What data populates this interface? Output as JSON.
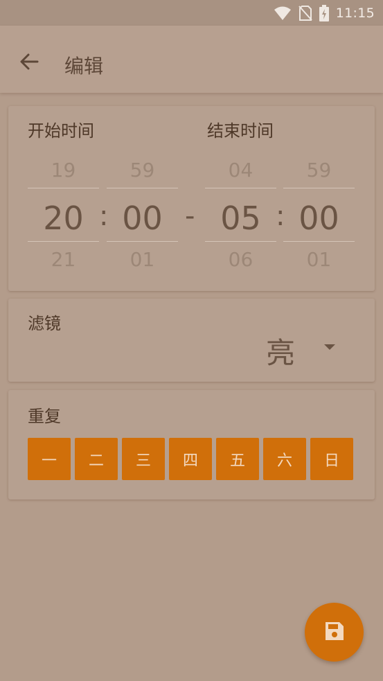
{
  "status_bar": {
    "time": "11:15",
    "icons": [
      "wifi-icon",
      "no-sim-icon",
      "battery-charging-icon"
    ]
  },
  "toolbar": {
    "title": "编辑",
    "back_icon": "arrow-back-icon"
  },
  "time_card": {
    "start_label": "开始时间",
    "end_label": "结束时间",
    "separator_colon": ":",
    "separator_dash": "-",
    "start_hour": {
      "prev": "19",
      "current": "20",
      "next": "21"
    },
    "start_minute": {
      "prev": "59",
      "current": "00",
      "next": "01"
    },
    "end_hour": {
      "prev": "04",
      "current": "05",
      "next": "06"
    },
    "end_minute": {
      "prev": "59",
      "current": "00",
      "next": "01"
    }
  },
  "filter_card": {
    "label": "滤镜",
    "selected": "亮"
  },
  "repeat_card": {
    "label": "重复",
    "days": [
      "一",
      "二",
      "三",
      "四",
      "五",
      "六",
      "日"
    ]
  },
  "fab": {
    "icon": "save-icon"
  },
  "colors": {
    "accent": "#d06f0a",
    "background": "#b39c8b",
    "card": "#b6a090",
    "text_dark": "#4e3828"
  }
}
